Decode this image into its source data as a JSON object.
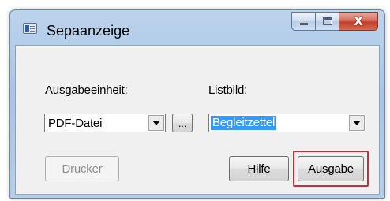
{
  "window": {
    "title": "Sepaanzeige",
    "app_icon": "sepa-app-icon"
  },
  "caption_buttons": {
    "minimize": "minimize-icon",
    "maximize": "maximize-icon",
    "close": "close-icon",
    "close_glyph": "X"
  },
  "form": {
    "ausgabeeinheit_label": "Ausgabeeinheit:",
    "ausgabeeinheit_value": "PDF-Datei",
    "browse_button_label": "...",
    "listbild_label": "Listbild:",
    "listbild_value": "Begleitzettel"
  },
  "buttons": {
    "drucker_label": "Drucker",
    "drucker_enabled": false,
    "hilfe_label": "Hilfe",
    "ausgabe_label": "Ausgabe"
  },
  "colors": {
    "selection": "#3399ff",
    "highlight_frame": "#c0303a"
  }
}
